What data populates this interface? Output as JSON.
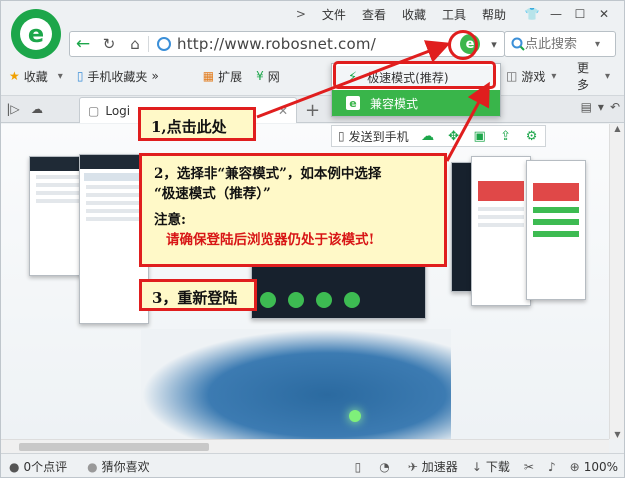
{
  "menu": {
    "items": [
      "文件",
      "查看",
      "收藏",
      "工具",
      "帮助"
    ],
    "chevron": ">"
  },
  "address": {
    "url": "http://www.robosnet.com/",
    "kernel_icon": "e"
  },
  "search": {
    "placeholder": "点此搜索"
  },
  "favorites": {
    "favorites_label": "收藏",
    "mobile_label": "手机收藏夹",
    "more_chevron": "»",
    "extensions_label": "扩展",
    "net_label": "网",
    "games_label": "游戏",
    "more_label": "更多"
  },
  "tabs": {
    "active_title": "Logi",
    "new_tab": "+"
  },
  "dropdown": {
    "fast_mode": "极速模式(推荐)",
    "compat_mode": "兼容模式"
  },
  "page_tools": {
    "send_to_phone": "发送到手机"
  },
  "callouts": {
    "step1": "1,点击此处",
    "step2_line1": "2，选择非“兼容模式”，如本例中选择",
    "step2_line2": "“极速模式（推荐）”",
    "note_label": "注意:",
    "note_text": "请确保登陆后浏览器仍处于该模式!",
    "step3": "3，重新登陆"
  },
  "status": {
    "comments": "0个点评",
    "guess_like": "猜你喜欢",
    "accelerator": "加速器",
    "download": "下载",
    "zoom": "100%"
  },
  "colors": {
    "brand_green": "#1ca64a",
    "highlight_red": "#e01e1e",
    "callout_bg": "#fff9c8",
    "compat_green": "#39b54a"
  }
}
